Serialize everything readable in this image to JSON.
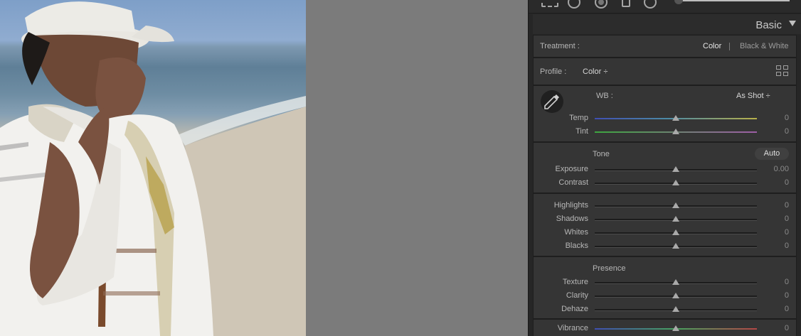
{
  "panel": {
    "title": "Basic",
    "treatment": {
      "label": "Treatment :",
      "options": [
        "Color",
        "Black & White"
      ],
      "active": "Color"
    },
    "profile": {
      "label": "Profile :",
      "value": "Color ÷"
    },
    "wb": {
      "label": "WB :",
      "value": "As Shot ÷"
    },
    "temp": {
      "label": "Temp",
      "value": "0",
      "level": 0.5
    },
    "tint": {
      "label": "Tint",
      "value": "0",
      "level": 0.5
    },
    "tone": {
      "label": "Tone",
      "auto": "Auto"
    },
    "exposure": {
      "label": "Exposure",
      "value": "0.00",
      "level": 0.5
    },
    "contrast": {
      "label": "Contrast",
      "value": "0",
      "level": 0.5
    },
    "highlights": {
      "label": "Highlights",
      "value": "0",
      "level": 0.5
    },
    "shadows": {
      "label": "Shadows",
      "value": "0",
      "level": 0.5
    },
    "whites": {
      "label": "Whites",
      "value": "0",
      "level": 0.5
    },
    "blacks": {
      "label": "Blacks",
      "value": "0",
      "level": 0.5
    },
    "presence": {
      "label": "Presence"
    },
    "texture": {
      "label": "Texture",
      "value": "0",
      "level": 0.5
    },
    "clarity": {
      "label": "Clarity",
      "value": "0",
      "level": 0.5
    },
    "dehaze": {
      "label": "Dehaze",
      "value": "0",
      "level": 0.5
    },
    "vibrance": {
      "label": "Vibrance",
      "value": "0",
      "level": 0.5
    }
  },
  "icons": {
    "collapse": "triangle-down-icon",
    "profile_browser": "grid-icon",
    "wb_selector": "eyedropper-icon"
  },
  "colors": {
    "panel_bg": "#353535",
    "canvas_bg": "#7b7b7b",
    "active_text": "#e6e6e6"
  }
}
